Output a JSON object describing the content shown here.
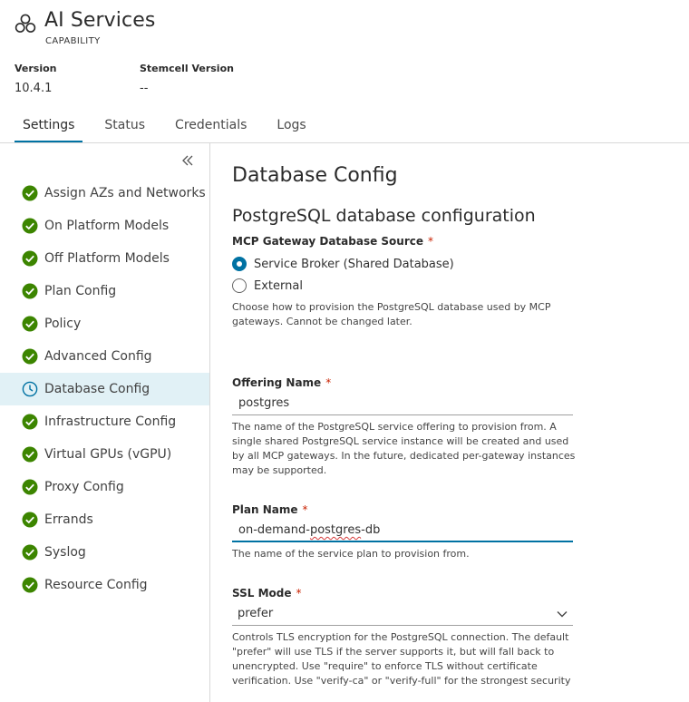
{
  "header": {
    "title": "AI Services",
    "subtitle": "CAPABILITY",
    "icon": "hexagon-cluster-icon"
  },
  "meta": {
    "version_label": "Version",
    "version_value": "10.4.1",
    "stemcell_label": "Stemcell Version",
    "stemcell_value": "--"
  },
  "tabs": [
    {
      "label": "Settings",
      "active": true
    },
    {
      "label": "Status"
    },
    {
      "label": "Credentials"
    },
    {
      "label": "Logs"
    }
  ],
  "sidebar": {
    "collapse_icon": "double-chevron-left-icon",
    "items": [
      {
        "label": "Assign AZs and Networks",
        "status": "complete"
      },
      {
        "label": "On Platform Models",
        "status": "complete"
      },
      {
        "label": "Off Platform Models",
        "status": "complete"
      },
      {
        "label": "Plan Config",
        "status": "complete"
      },
      {
        "label": "Policy",
        "status": "complete"
      },
      {
        "label": "Advanced Config",
        "status": "complete"
      },
      {
        "label": "Database Config",
        "status": "in-progress",
        "active": true
      },
      {
        "label": "Infrastructure Config",
        "status": "complete"
      },
      {
        "label": "Virtual GPUs (vGPU)",
        "status": "complete"
      },
      {
        "label": "Proxy Config",
        "status": "complete"
      },
      {
        "label": "Errands",
        "status": "complete"
      },
      {
        "label": "Syslog",
        "status": "complete"
      },
      {
        "label": "Resource Config",
        "status": "complete"
      }
    ]
  },
  "main": {
    "title": "Database Config",
    "section_title": "PostgreSQL database configuration",
    "source": {
      "label": "MCP Gateway Database Source",
      "required_mark": "*",
      "options": [
        {
          "label": "Service Broker (Shared Database)",
          "checked": true
        },
        {
          "label": "External",
          "checked": false
        }
      ],
      "help_line1": "Choose how to provision the PostgreSQL database used by MCP",
      "help_line2": "gateways. Cannot be changed later."
    },
    "offering": {
      "label": "Offering Name",
      "required_mark": "*",
      "value": "postgres",
      "help_line1": "The name of the PostgreSQL service offering to provision from. A",
      "help_line2": "single shared PostgreSQL service instance will be created and used",
      "help_line3": "by all MCP gateways. In the future, dedicated per-gateway instances",
      "help_line4": "may be supported."
    },
    "plan": {
      "label": "Plan Name",
      "required_mark": "*",
      "value_prefix": "on-demand-",
      "value_misspelled": "postgres",
      "value_suffix": "-db",
      "help": "The name of the service plan to provision from."
    },
    "ssl": {
      "label": "SSL Mode",
      "required_mark": "*",
      "selected": "prefer",
      "help_line1": "Controls TLS encryption for the PostgreSQL connection. The default",
      "help_line2": "\"prefer\" will use TLS if the server supports it, but will fall back to",
      "help_line3": "unencrypted. Use \"require\" to enforce TLS without certificate",
      "help_line4": "verification. Use \"verify-ca\" or \"verify-full\" for the strongest security"
    }
  },
  "colors": {
    "accent": "#0072a3",
    "success": "#3c8500",
    "required": "#c92100",
    "active_bg": "#e1f1f6"
  }
}
